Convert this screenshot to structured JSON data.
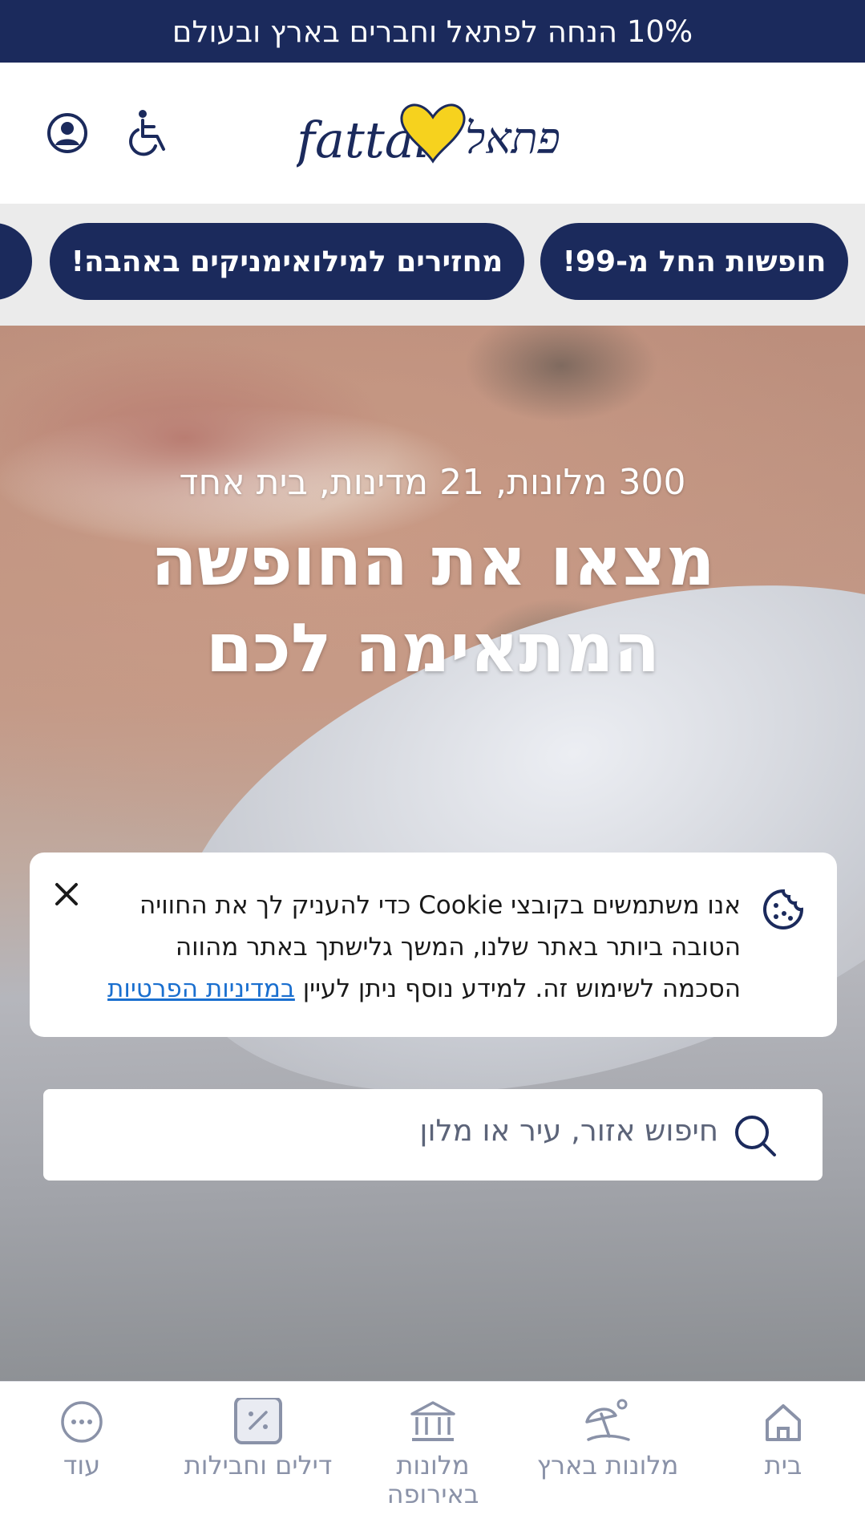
{
  "top_banner": {
    "text": "10% הנחה לפתאל וחברים בארץ ובעולם"
  },
  "header": {
    "user_icon": "user-circle-icon",
    "accessibility_icon": "wheelchair-icon",
    "logo_text_latin": "fattal",
    "logo_text_hebrew": "פתאל",
    "logo_colors": {
      "navy": "#1b2a5c",
      "yellow": "#f6d21e"
    }
  },
  "promo_pills": [
    {
      "label": "חופשות החל מ-99!"
    },
    {
      "label": "מחזירים למילואימניקים באהבה!"
    },
    {
      "label": ""
    }
  ],
  "hero": {
    "subtitle": "300 מלונות, 21 מדינות, בית אחד",
    "title": "מצאו את החופשה המתאימה לכם"
  },
  "cookie_notice": {
    "text": "אנו משתמשים בקובצי Cookie כדי להעניק לך את החוויה הטובה ביותר באתר שלנו, המשך גלישתך באתר מהווה הסכמה לשימוש זה. למידע נוסף ניתן לעיין",
    "link_text": "במדיניות הפרטיות",
    "icon": "cookie-icon",
    "close_icon": "close-icon"
  },
  "search": {
    "placeholder": "חיפוש אזור, עיר או מלון",
    "icon": "search-icon"
  },
  "bottom_nav": {
    "items": [
      {
        "label": "בית",
        "icon": "home-icon"
      },
      {
        "label": "מלונות בארץ",
        "icon": "beach-umbrella-icon"
      },
      {
        "label": "מלונות באירופה",
        "icon": "building-columns-icon"
      },
      {
        "label": "דילים וחבילות",
        "icon": "percent-tag-icon"
      },
      {
        "label": "עוד",
        "icon": "more-dots-icon"
      }
    ]
  },
  "colors": {
    "brand_navy": "#1b2a5c",
    "link_blue": "#1a6fcf",
    "nav_gray": "#8a92a8"
  }
}
